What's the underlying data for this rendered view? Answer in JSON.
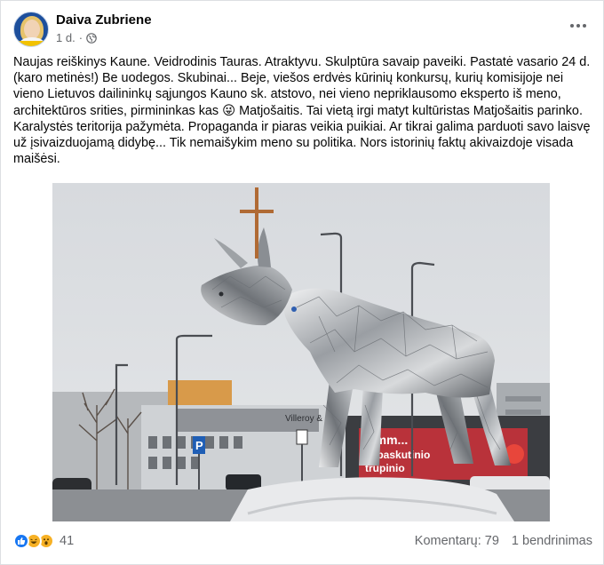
{
  "post": {
    "author": "Daiva Zubriene",
    "time": "1 d.",
    "separator": "·",
    "body": "Naujas reiškinys Kaune. Veidrodinis Tauras. Atraktyvu. Skulptūra savaip paveiki. Pastatė vasario 24 d. (karo metinės!) Be uodegos. Skubinai... Beje, viešos erdvės kūrinių konkursų, kurių komisijoje nei vieno Lietuvos dailininkų sąjungos Kauno sk. atstovo, nei vieno nepriklausomo eksperto iš meno, architektūros srities, pirmininkas kas 😜 Matjošaitis. Tai vietą irgi matyt kultūristas Matjošaitis parinko. Karalystės teritorija pažymėta. Propaganda ir piaras veikia puikiai. Ar tikrai galima parduoti savo laisvę už įsivaizduojamą didybę... Tik nemaišykim meno su politika. Nors istorinių faktų akivaizdoje visada maišėsi."
  },
  "photo_signs": {
    "building_sign": "Villeroy & Boch",
    "billboard_line1": "Mmm...",
    "billboard_line2": "ki paskutinio",
    "billboard_line3": "trupinio",
    "parking": "P"
  },
  "footer": {
    "reaction_icons": [
      "like-icon",
      "haha-icon",
      "wow-icon"
    ],
    "reaction_count": "41",
    "comments": "Komentarų: 79",
    "shares": "1 bendrinimas"
  },
  "colors": {
    "like": "#1877f2",
    "reaction_yellow": "#f7b125",
    "secondary_text": "#65676b"
  }
}
